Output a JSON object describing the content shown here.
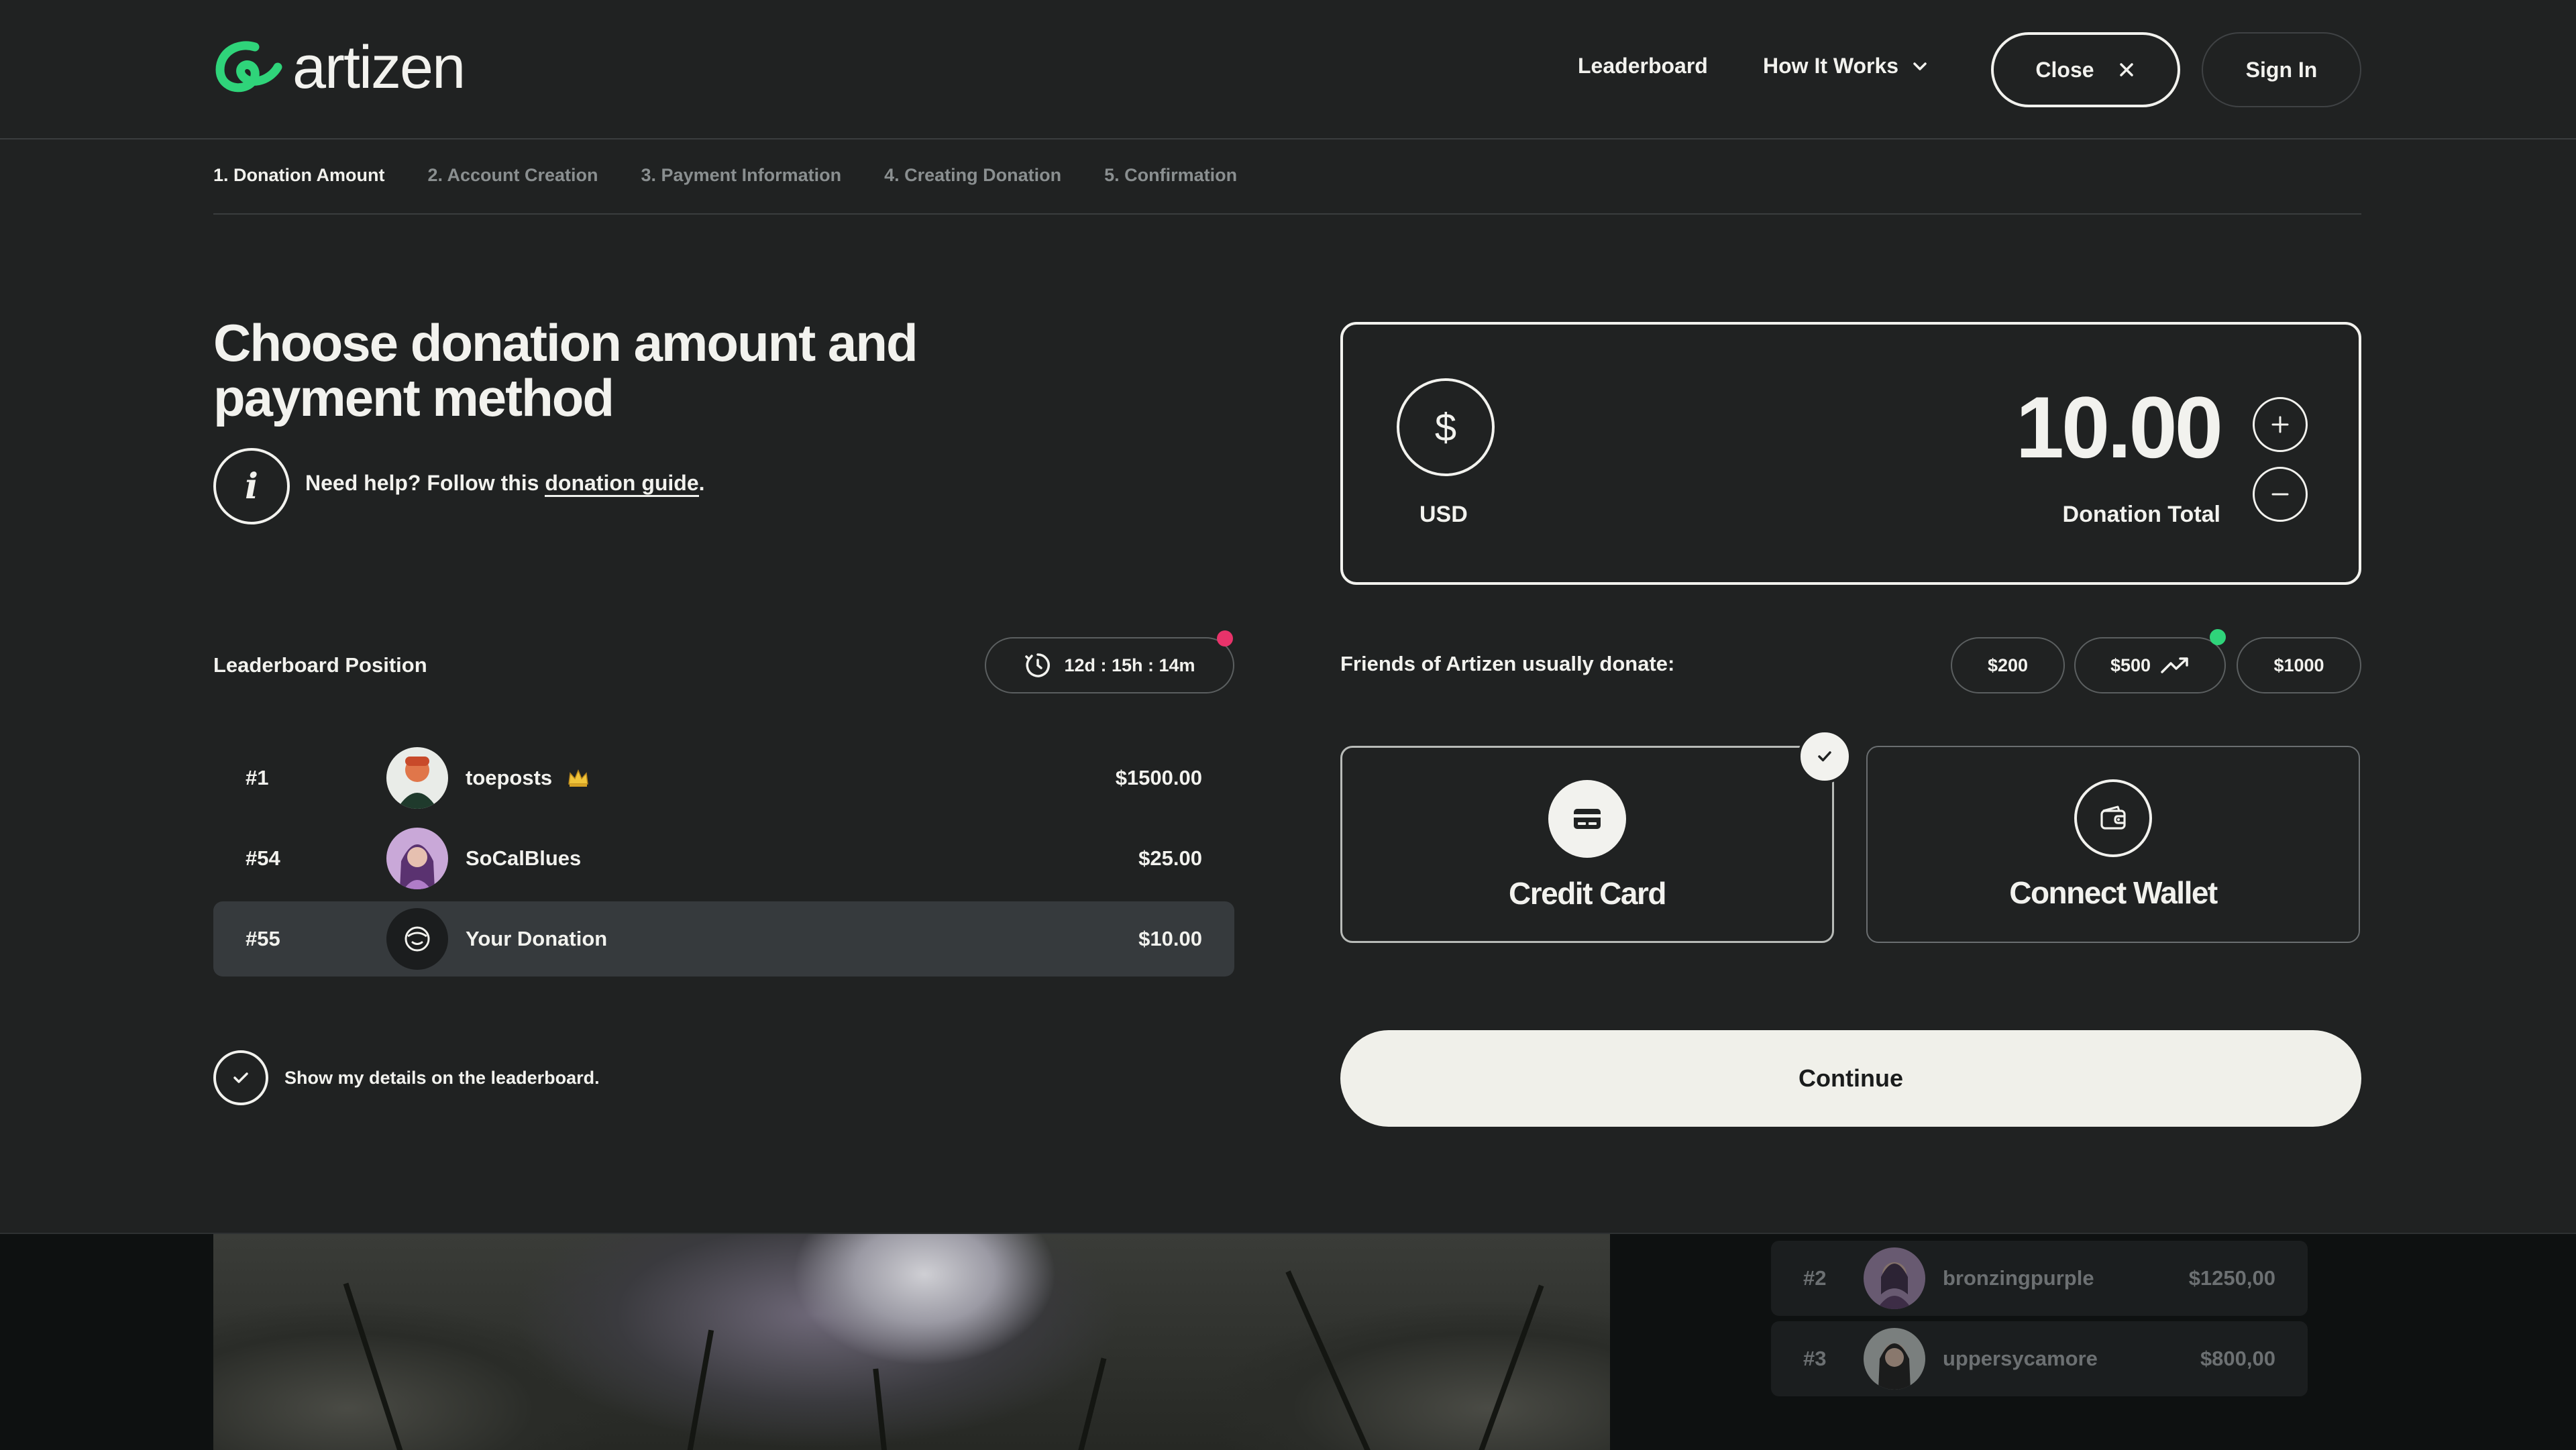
{
  "brand": {
    "name": "artizen",
    "accent": "#2fd47a"
  },
  "nav": {
    "leaderboard": "Leaderboard",
    "how_it_works": "How It Works",
    "close": "Close",
    "sign_in": "Sign In"
  },
  "steps": [
    {
      "label": "1. Donation Amount",
      "active": true
    },
    {
      "label": "2. Account Creation",
      "active": false
    },
    {
      "label": "3. Payment Information",
      "active": false
    },
    {
      "label": "4. Creating Donation",
      "active": false
    },
    {
      "label": "5. Confirmation",
      "active": false
    }
  ],
  "main": {
    "title_line1": "Choose donation amount and",
    "title_line2": "payment method",
    "help_prefix": "Need help? Follow this",
    "help_link": "donation guide",
    "help_suffix": "."
  },
  "leaderboard": {
    "title": "Leaderboard Position",
    "timer": "12d : 15h : 14m",
    "rows": [
      {
        "rank": "#1",
        "name": "toeposts",
        "amount": "$1500.00",
        "badge": "crown-icon"
      },
      {
        "rank": "#54",
        "name": "SoCalBlues",
        "amount": "$25.00"
      },
      {
        "rank": "#55",
        "name": "Your Donation",
        "amount": "$10.00",
        "is_self": true
      }
    ],
    "show_details_label": "Show my details on the leaderboard.",
    "show_details_checked": true
  },
  "donation": {
    "currency_symbol": "$",
    "currency": "USD",
    "amount": "10.00",
    "total_label": "Donation Total",
    "increment": "+",
    "decrement": "−"
  },
  "suggestions": {
    "label": "Friends of Artizen usually donate:",
    "options": [
      {
        "label": "$200"
      },
      {
        "label": "$500",
        "trending": true
      },
      {
        "label": "$1000"
      }
    ]
  },
  "payment": {
    "methods": [
      {
        "label": "Credit Card",
        "selected": true,
        "icon": "credit-card-icon"
      },
      {
        "label": "Connect Wallet",
        "selected": false,
        "icon": "wallet-icon"
      }
    ]
  },
  "continue_label": "Continue",
  "background_rows": [
    {
      "rank": "#2",
      "name": "bronzingpurple",
      "amount": "$1250,00"
    },
    {
      "rank": "#3",
      "name": "uppersycamore",
      "amount": "$800,00"
    }
  ]
}
